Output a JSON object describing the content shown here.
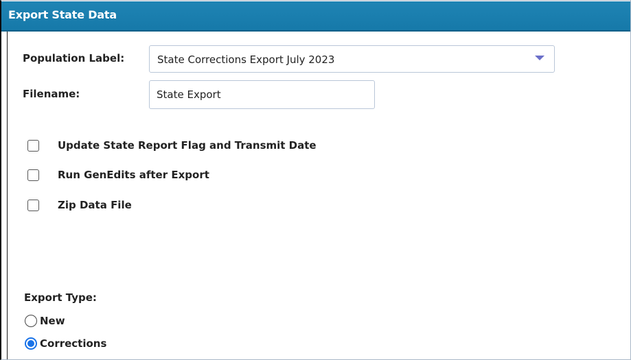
{
  "window": {
    "title": "Export State Data"
  },
  "form": {
    "population_label": {
      "label": "Population Label:",
      "value": "State Corrections Export July 2023"
    },
    "filename": {
      "label": "Filename:",
      "value": "State Export"
    },
    "checkboxes": [
      {
        "label": "Update State Report Flag and Transmit Date",
        "checked": false
      },
      {
        "label": "Run GenEdits after Export",
        "checked": false
      },
      {
        "label": "Zip Data File",
        "checked": false
      }
    ],
    "export_type": {
      "label": "Export Type:",
      "options": [
        {
          "label": "New",
          "selected": false
        },
        {
          "label": "Corrections",
          "selected": true
        }
      ]
    }
  },
  "colors": {
    "title_bar": "#1a7fb0",
    "title_text": "#ffffff",
    "radio_selected": "#1a73e8",
    "dropdown_arrow": "#6b6fc9"
  }
}
